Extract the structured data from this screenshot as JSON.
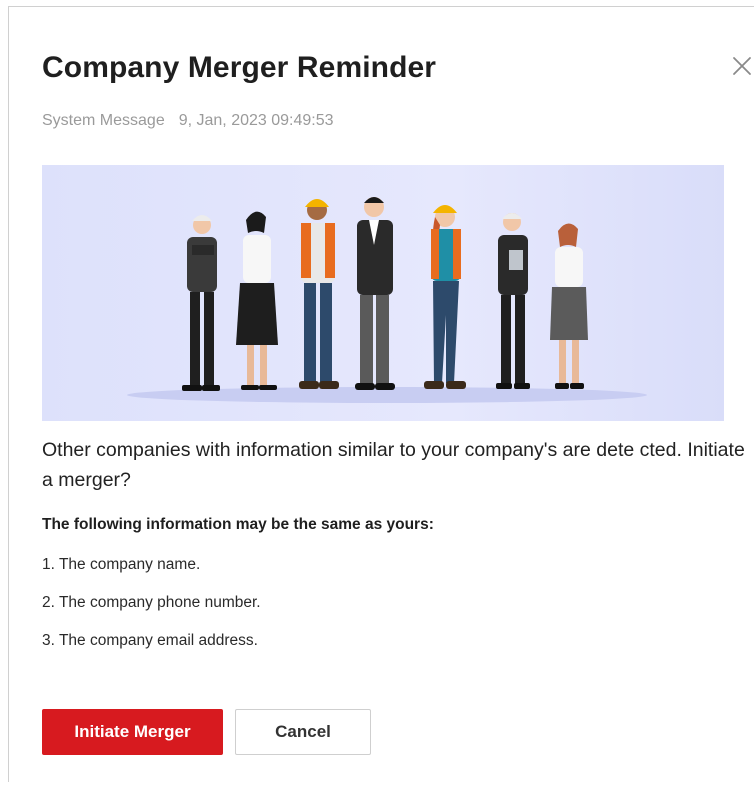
{
  "dialog": {
    "title": "Company Merger Reminder",
    "meta": {
      "source": "System Message",
      "timestamp": "9, Jan, 2023 09:49:53"
    },
    "question": "Other companies with information similar to your company's are dete cted. Initiate a merger?",
    "info_heading": "The following information may be the same as yours:",
    "info_items": [
      "1. The company name.",
      "2. The company phone number.",
      "3. The company email address."
    ],
    "buttons": {
      "primary": "Initiate Merger",
      "secondary": "Cancel"
    }
  },
  "icons": {
    "close": "close-icon"
  },
  "colors": {
    "primary": "#d71a1f",
    "banner": "#dde1fb",
    "meta_text": "#9a9a9a"
  }
}
